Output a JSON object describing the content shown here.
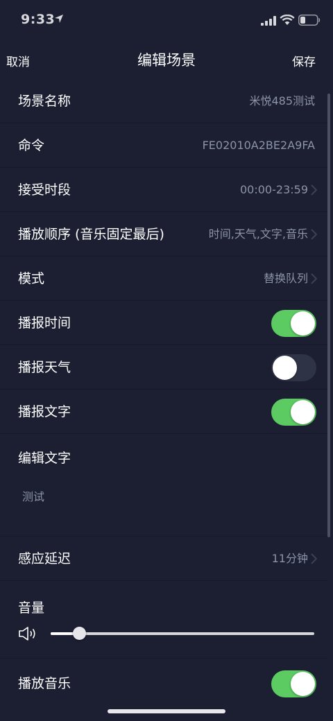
{
  "status_bar": {
    "time": "9:33"
  },
  "nav": {
    "cancel": "取消",
    "title": "编辑场景",
    "save": "保存"
  },
  "rows": {
    "scene_name": {
      "label": "场景名称",
      "value": "米悦485测试"
    },
    "command": {
      "label": "命令",
      "value": "FE02010A2BE2A9FA"
    },
    "accept_period": {
      "label": "接受时段",
      "value": "00:00-23:59"
    },
    "play_order": {
      "label": "播放顺序 (音乐固定最后)",
      "value": "时间,天气,文字,音乐"
    },
    "mode": {
      "label": "模式",
      "value": "替换队列"
    },
    "announce_time": {
      "label": "播报时间",
      "on": true
    },
    "announce_weather": {
      "label": "播报天气",
      "on": false
    },
    "announce_text": {
      "label": "播报文字",
      "on": true
    },
    "sensor_delay": {
      "label": "感应延迟",
      "value": "11分钟"
    },
    "play_music": {
      "label": "播放音乐",
      "on": true
    }
  },
  "edit_text": {
    "label": "编辑文字",
    "content": "测试"
  },
  "volume": {
    "label": "音量",
    "level": 0.11
  },
  "colors": {
    "background": "#1b1f31",
    "toggle_on": "#5ccb62",
    "toggle_off": "#2f3346",
    "secondary_text": "#8d93a8"
  }
}
